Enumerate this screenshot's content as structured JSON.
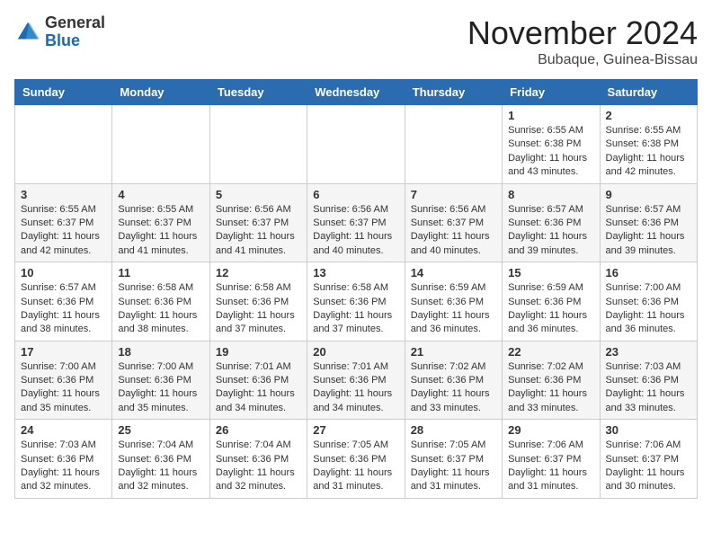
{
  "header": {
    "logo_general": "General",
    "logo_blue": "Blue",
    "month_title": "November 2024",
    "location": "Bubaque, Guinea-Bissau"
  },
  "calendar": {
    "days_of_week": [
      "Sunday",
      "Monday",
      "Tuesday",
      "Wednesday",
      "Thursday",
      "Friday",
      "Saturday"
    ],
    "weeks": [
      [
        {
          "day": "",
          "info": ""
        },
        {
          "day": "",
          "info": ""
        },
        {
          "day": "",
          "info": ""
        },
        {
          "day": "",
          "info": ""
        },
        {
          "day": "",
          "info": ""
        },
        {
          "day": "1",
          "info": "Sunrise: 6:55 AM\nSunset: 6:38 PM\nDaylight: 11 hours and 43 minutes."
        },
        {
          "day": "2",
          "info": "Sunrise: 6:55 AM\nSunset: 6:38 PM\nDaylight: 11 hours and 42 minutes."
        }
      ],
      [
        {
          "day": "3",
          "info": "Sunrise: 6:55 AM\nSunset: 6:37 PM\nDaylight: 11 hours and 42 minutes."
        },
        {
          "day": "4",
          "info": "Sunrise: 6:55 AM\nSunset: 6:37 PM\nDaylight: 11 hours and 41 minutes."
        },
        {
          "day": "5",
          "info": "Sunrise: 6:56 AM\nSunset: 6:37 PM\nDaylight: 11 hours and 41 minutes."
        },
        {
          "day": "6",
          "info": "Sunrise: 6:56 AM\nSunset: 6:37 PM\nDaylight: 11 hours and 40 minutes."
        },
        {
          "day": "7",
          "info": "Sunrise: 6:56 AM\nSunset: 6:37 PM\nDaylight: 11 hours and 40 minutes."
        },
        {
          "day": "8",
          "info": "Sunrise: 6:57 AM\nSunset: 6:36 PM\nDaylight: 11 hours and 39 minutes."
        },
        {
          "day": "9",
          "info": "Sunrise: 6:57 AM\nSunset: 6:36 PM\nDaylight: 11 hours and 39 minutes."
        }
      ],
      [
        {
          "day": "10",
          "info": "Sunrise: 6:57 AM\nSunset: 6:36 PM\nDaylight: 11 hours and 38 minutes."
        },
        {
          "day": "11",
          "info": "Sunrise: 6:58 AM\nSunset: 6:36 PM\nDaylight: 11 hours and 38 minutes."
        },
        {
          "day": "12",
          "info": "Sunrise: 6:58 AM\nSunset: 6:36 PM\nDaylight: 11 hours and 37 minutes."
        },
        {
          "day": "13",
          "info": "Sunrise: 6:58 AM\nSunset: 6:36 PM\nDaylight: 11 hours and 37 minutes."
        },
        {
          "day": "14",
          "info": "Sunrise: 6:59 AM\nSunset: 6:36 PM\nDaylight: 11 hours and 36 minutes."
        },
        {
          "day": "15",
          "info": "Sunrise: 6:59 AM\nSunset: 6:36 PM\nDaylight: 11 hours and 36 minutes."
        },
        {
          "day": "16",
          "info": "Sunrise: 7:00 AM\nSunset: 6:36 PM\nDaylight: 11 hours and 36 minutes."
        }
      ],
      [
        {
          "day": "17",
          "info": "Sunrise: 7:00 AM\nSunset: 6:36 PM\nDaylight: 11 hours and 35 minutes."
        },
        {
          "day": "18",
          "info": "Sunrise: 7:00 AM\nSunset: 6:36 PM\nDaylight: 11 hours and 35 minutes."
        },
        {
          "day": "19",
          "info": "Sunrise: 7:01 AM\nSunset: 6:36 PM\nDaylight: 11 hours and 34 minutes."
        },
        {
          "day": "20",
          "info": "Sunrise: 7:01 AM\nSunset: 6:36 PM\nDaylight: 11 hours and 34 minutes."
        },
        {
          "day": "21",
          "info": "Sunrise: 7:02 AM\nSunset: 6:36 PM\nDaylight: 11 hours and 33 minutes."
        },
        {
          "day": "22",
          "info": "Sunrise: 7:02 AM\nSunset: 6:36 PM\nDaylight: 11 hours and 33 minutes."
        },
        {
          "day": "23",
          "info": "Sunrise: 7:03 AM\nSunset: 6:36 PM\nDaylight: 11 hours and 33 minutes."
        }
      ],
      [
        {
          "day": "24",
          "info": "Sunrise: 7:03 AM\nSunset: 6:36 PM\nDaylight: 11 hours and 32 minutes."
        },
        {
          "day": "25",
          "info": "Sunrise: 7:04 AM\nSunset: 6:36 PM\nDaylight: 11 hours and 32 minutes."
        },
        {
          "day": "26",
          "info": "Sunrise: 7:04 AM\nSunset: 6:36 PM\nDaylight: 11 hours and 32 minutes."
        },
        {
          "day": "27",
          "info": "Sunrise: 7:05 AM\nSunset: 6:36 PM\nDaylight: 11 hours and 31 minutes."
        },
        {
          "day": "28",
          "info": "Sunrise: 7:05 AM\nSunset: 6:37 PM\nDaylight: 11 hours and 31 minutes."
        },
        {
          "day": "29",
          "info": "Sunrise: 7:06 AM\nSunset: 6:37 PM\nDaylight: 11 hours and 31 minutes."
        },
        {
          "day": "30",
          "info": "Sunrise: 7:06 AM\nSunset: 6:37 PM\nDaylight: 11 hours and 30 minutes."
        }
      ]
    ]
  }
}
